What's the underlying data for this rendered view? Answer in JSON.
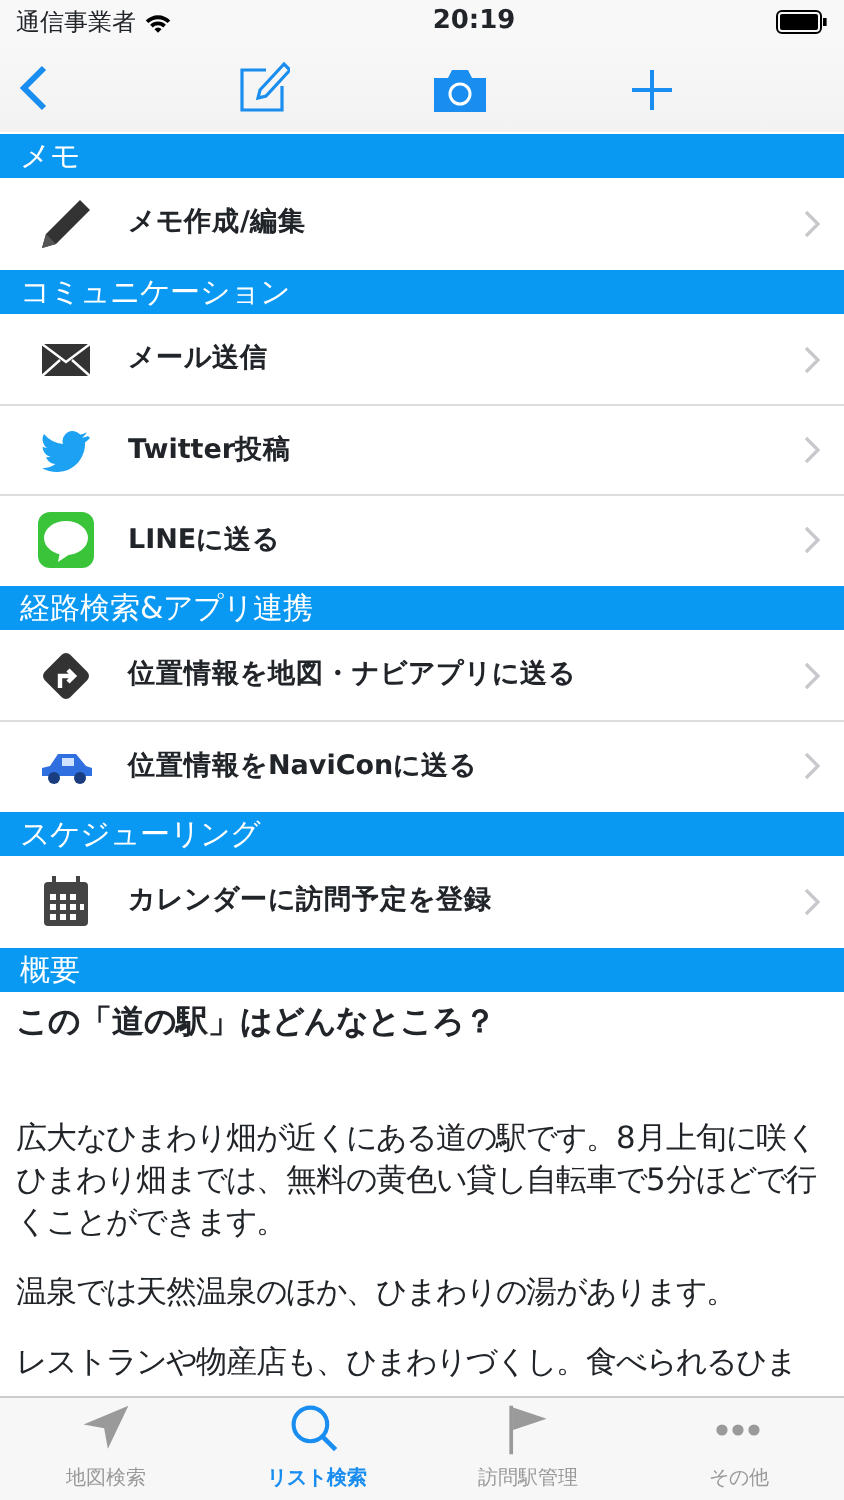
{
  "status_bar": {
    "carrier": "通信事業者",
    "time": "20:19"
  },
  "sections": [
    {
      "title": "メモ",
      "items": [
        {
          "label": "メモ作成/編集"
        }
      ]
    },
    {
      "title": "コミュニケーション",
      "items": [
        {
          "label": "メール送信"
        },
        {
          "label": "Twitter投稿"
        },
        {
          "label": "LINEに送る"
        }
      ]
    },
    {
      "title": "経路検索&アプリ連携",
      "items": [
        {
          "label": "位置情報を地図・ナビアプリに送る"
        },
        {
          "label": "位置情報をNaviConに送る"
        }
      ]
    },
    {
      "title": "スケジューリング",
      "items": [
        {
          "label": "カレンダーに訪問予定を登録"
        }
      ]
    }
  ],
  "overview": {
    "title": "概要",
    "heading": "この「道の駅」はどんなところ？",
    "paragraphs": [
      "広大なひまわり畑が近くにある道の駅です。8月上旬に咲くひまわり畑までは、無料の黄色い貸し自転車で5分ほどで行くことができます。",
      "温泉では天然温泉のほか、ひまわりの湯があります。",
      "レストランや物産店も、ひまわりづくし。食べられるひま"
    ]
  },
  "tabs": [
    {
      "label": "地図検索",
      "selected": false
    },
    {
      "label": "リスト検索",
      "selected": true
    },
    {
      "label": "訪問駅管理",
      "selected": false
    },
    {
      "label": "その他",
      "selected": false
    }
  ]
}
